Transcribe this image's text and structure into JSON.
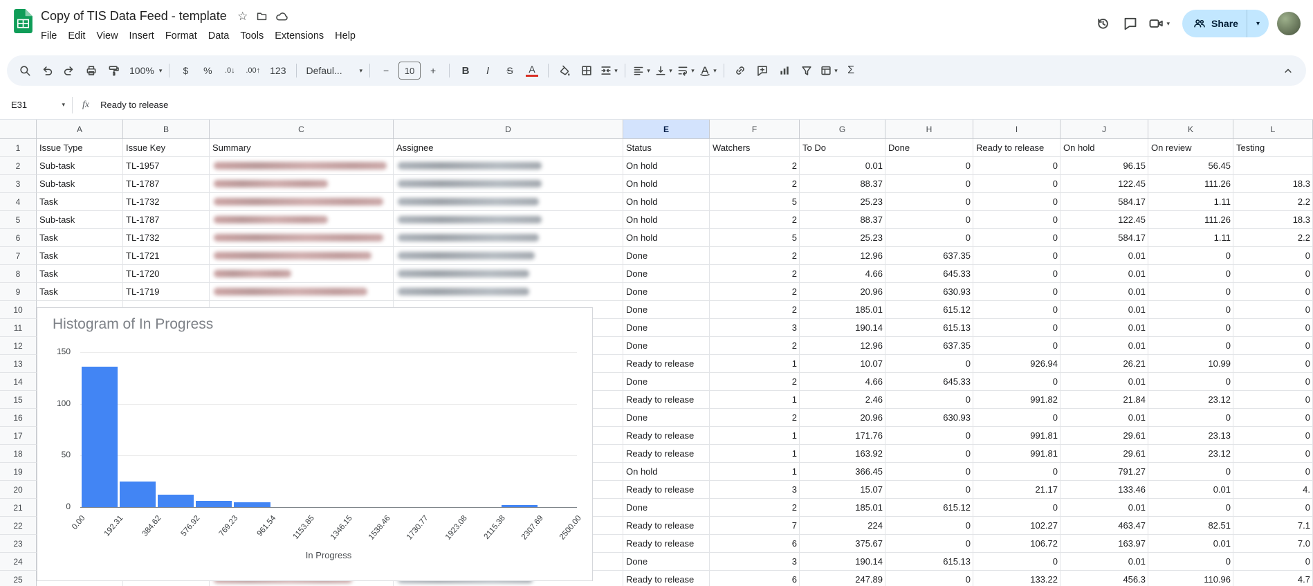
{
  "titlebar": {
    "doc_title": "Copy of TIS Data Feed - template",
    "menus": [
      "File",
      "Edit",
      "View",
      "Insert",
      "Format",
      "Data",
      "Tools",
      "Extensions",
      "Help"
    ],
    "share_label": "Share",
    "doc_actions": [
      "star-icon",
      "move-icon",
      "document-status-icon"
    ],
    "right_actions": [
      "version-history-icon",
      "comments-icon",
      "meet-video-icon",
      "share-button",
      "account-avatar"
    ]
  },
  "toolbar": {
    "items": [
      {
        "name": "menus-search-icon",
        "kind": "icon",
        "icon": "search"
      },
      {
        "name": "undo-icon",
        "kind": "icon",
        "icon": "undo"
      },
      {
        "name": "redo-icon",
        "kind": "icon",
        "icon": "redo"
      },
      {
        "name": "print-icon",
        "kind": "icon",
        "icon": "print"
      },
      {
        "name": "paint-format-icon",
        "kind": "icon",
        "icon": "paint"
      },
      {
        "name": "zoom-select",
        "kind": "select",
        "label": "100%",
        "caret": true
      },
      {
        "kind": "divider"
      },
      {
        "name": "currency-format-button",
        "kind": "text",
        "label": "$"
      },
      {
        "name": "percent-format-button",
        "kind": "text",
        "label": "%"
      },
      {
        "name": "decrease-decimal-button",
        "kind": "text",
        "label": ".0↓",
        "small": true
      },
      {
        "name": "increase-decimal-button",
        "kind": "text",
        "label": ".00↑",
        "small": true
      },
      {
        "name": "number-format-button",
        "kind": "text",
        "label": "123"
      },
      {
        "kind": "divider"
      },
      {
        "name": "font-select",
        "kind": "select",
        "label": "Defaul...",
        "caret": true,
        "wide": true
      },
      {
        "kind": "divider"
      },
      {
        "name": "decrease-font-size-button",
        "kind": "text",
        "label": "−"
      },
      {
        "name": "font-size-input",
        "kind": "input",
        "value": "10"
      },
      {
        "name": "increase-font-size-button",
        "kind": "text",
        "label": "+"
      },
      {
        "kind": "divider"
      },
      {
        "name": "bold-button",
        "kind": "text",
        "label": "B",
        "cls": "b"
      },
      {
        "name": "italic-button",
        "kind": "text",
        "label": "I",
        "cls": "i"
      },
      {
        "name": "strikethrough-button",
        "kind": "text",
        "label": "S",
        "cls": "s"
      },
      {
        "name": "text-color-button",
        "kind": "text",
        "label": "A",
        "cls": "tc"
      },
      {
        "kind": "divider"
      },
      {
        "name": "fill-color-icon",
        "kind": "icon",
        "icon": "bucket"
      },
      {
        "name": "borders-icon",
        "kind": "icon",
        "icon": "borders"
      },
      {
        "name": "merge-cells-icon",
        "kind": "icon",
        "icon": "merge",
        "caret": true
      },
      {
        "kind": "divider"
      },
      {
        "name": "horizontal-align-icon",
        "kind": "icon",
        "icon": "alignleft",
        "caret": true
      },
      {
        "name": "vertical-align-icon",
        "kind": "icon",
        "icon": "valign",
        "caret": true
      },
      {
        "name": "text-wrap-icon",
        "kind": "icon",
        "icon": "wrap",
        "caret": true
      },
      {
        "name": "text-rotation-icon",
        "kind": "icon",
        "icon": "rotate",
        "caret": true
      },
      {
        "kind": "divider"
      },
      {
        "name": "insert-link-icon",
        "kind": "icon",
        "icon": "link"
      },
      {
        "name": "insert-comment-icon",
        "kind": "icon",
        "icon": "addcomment"
      },
      {
        "name": "insert-chart-icon",
        "kind": "icon",
        "icon": "chart"
      },
      {
        "name": "create-filter-icon",
        "kind": "icon",
        "icon": "filter"
      },
      {
        "name": "table-views-icon",
        "kind": "icon",
        "icon": "views",
        "caret": true
      },
      {
        "name": "functions-button",
        "kind": "text",
        "label": "Σ",
        "cls": "sigma"
      }
    ],
    "collapse_name": "hide-toolbar-icon"
  },
  "formula_bar": {
    "cell_ref": "E31",
    "fx_label": "fx",
    "value": "Ready to release"
  },
  "grid": {
    "col_letters": [
      "A",
      "B",
      "C",
      "D",
      "E",
      "F",
      "G",
      "H",
      "I",
      "J",
      "K",
      "L"
    ],
    "active_column": "E",
    "rows": [
      {
        "n": "1",
        "type": "Issue Type",
        "key": "Issue Key",
        "summary": "Summary",
        "assignee": "Assignee",
        "status": "Status",
        "watchers": "Watchers",
        "todo": "To Do",
        "done": "Done",
        "ready": "Ready to release",
        "onhold": "On hold",
        "onreview": "On review",
        "testing": "Testing"
      },
      {
        "n": "2",
        "type": "Sub-task",
        "key": "TL-1957",
        "status": "On hold",
        "watchers": "2",
        "todo": "0.01",
        "done": "0",
        "ready": "0",
        "onhold": "96.15",
        "onreview": "56.45",
        "testing": "",
        "blur_summary": true,
        "blur_assignee": true
      },
      {
        "n": "3",
        "type": "Sub-task",
        "key": "TL-1787",
        "status": "On hold",
        "watchers": "2",
        "todo": "88.37",
        "done": "0",
        "ready": "0",
        "onhold": "122.45",
        "onreview": "111.26",
        "testing": "18.3",
        "blur_summary": true,
        "blur_assignee": true
      },
      {
        "n": "4",
        "type": "Task",
        "key": "TL-1732",
        "status": "On hold",
        "watchers": "5",
        "todo": "25.23",
        "done": "0",
        "ready": "0",
        "onhold": "584.17",
        "onreview": "1.11",
        "testing": "2.2",
        "blur_summary": true,
        "blur_assignee": true
      },
      {
        "n": "5",
        "type": "Sub-task",
        "key": "TL-1787",
        "status": "On hold",
        "watchers": "2",
        "todo": "88.37",
        "done": "0",
        "ready": "0",
        "onhold": "122.45",
        "onreview": "111.26",
        "testing": "18.3",
        "blur_summary": true,
        "blur_assignee": true
      },
      {
        "n": "6",
        "type": "Task",
        "key": "TL-1732",
        "status": "On hold",
        "watchers": "5",
        "todo": "25.23",
        "done": "0",
        "ready": "0",
        "onhold": "584.17",
        "onreview": "1.11",
        "testing": "2.2",
        "blur_summary": true,
        "blur_assignee": true
      },
      {
        "n": "7",
        "type": "Task",
        "key": "TL-1721",
        "status": "Done",
        "watchers": "2",
        "todo": "12.96",
        "done": "637.35",
        "ready": "0",
        "onhold": "0.01",
        "onreview": "0",
        "testing": "0",
        "blur_summary": true,
        "blur_assignee": true
      },
      {
        "n": "8",
        "type": "Task",
        "key": "TL-1720",
        "status": "Done",
        "watchers": "2",
        "todo": "4.66",
        "done": "645.33",
        "ready": "0",
        "onhold": "0.01",
        "onreview": "0",
        "testing": "0",
        "blur_summary": true,
        "blur_assignee": true
      },
      {
        "n": "9",
        "type": "Task",
        "key": "TL-1719",
        "status": "Done",
        "watchers": "2",
        "todo": "20.96",
        "done": "630.93",
        "ready": "0",
        "onhold": "0.01",
        "onreview": "0",
        "testing": "0",
        "blur_summary": true,
        "blur_assignee": true
      },
      {
        "n": "10",
        "status": "Done",
        "watchers": "2",
        "todo": "185.01",
        "done": "615.12",
        "ready": "0",
        "onhold": "0.01",
        "onreview": "0",
        "testing": "0"
      },
      {
        "n": "11",
        "status": "Done",
        "watchers": "3",
        "todo": "190.14",
        "done": "615.13",
        "ready": "0",
        "onhold": "0.01",
        "onreview": "0",
        "testing": "0"
      },
      {
        "n": "12",
        "status": "Done",
        "watchers": "2",
        "todo": "12.96",
        "done": "637.35",
        "ready": "0",
        "onhold": "0.01",
        "onreview": "0",
        "testing": "0"
      },
      {
        "n": "13",
        "status": "Ready to release",
        "watchers": "1",
        "todo": "10.07",
        "done": "0",
        "ready": "926.94",
        "onhold": "26.21",
        "onreview": "10.99",
        "testing": "0"
      },
      {
        "n": "14",
        "status": "Done",
        "watchers": "2",
        "todo": "4.66",
        "done": "645.33",
        "ready": "0",
        "onhold": "0.01",
        "onreview": "0",
        "testing": "0"
      },
      {
        "n": "15",
        "status": "Ready to release",
        "watchers": "1",
        "todo": "2.46",
        "done": "0",
        "ready": "991.82",
        "onhold": "21.84",
        "onreview": "23.12",
        "testing": "0"
      },
      {
        "n": "16",
        "status": "Done",
        "watchers": "2",
        "todo": "20.96",
        "done": "630.93",
        "ready": "0",
        "onhold": "0.01",
        "onreview": "0",
        "testing": "0"
      },
      {
        "n": "17",
        "status": "Ready to release",
        "watchers": "1",
        "todo": "171.76",
        "done": "0",
        "ready": "991.81",
        "onhold": "29.61",
        "onreview": "23.13",
        "testing": "0"
      },
      {
        "n": "18",
        "status": "Ready to release",
        "watchers": "1",
        "todo": "163.92",
        "done": "0",
        "ready": "991.81",
        "onhold": "29.61",
        "onreview": "23.12",
        "testing": "0"
      },
      {
        "n": "19",
        "status": "On hold",
        "watchers": "1",
        "todo": "366.45",
        "done": "0",
        "ready": "0",
        "onhold": "791.27",
        "onreview": "0",
        "testing": "0"
      },
      {
        "n": "20",
        "status": "Ready to release",
        "watchers": "3",
        "todo": "15.07",
        "done": "0",
        "ready": "21.17",
        "onhold": "133.46",
        "onreview": "0.01",
        "testing": "4."
      },
      {
        "n": "21",
        "status": "Done",
        "watchers": "2",
        "todo": "185.01",
        "done": "615.12",
        "ready": "0",
        "onhold": "0.01",
        "onreview": "0",
        "testing": "0"
      },
      {
        "n": "22",
        "status": "Ready to release",
        "watchers": "7",
        "todo": "224",
        "done": "0",
        "ready": "102.27",
        "onhold": "463.47",
        "onreview": "82.51",
        "testing": "7.1"
      },
      {
        "n": "23",
        "status": "Ready to release",
        "watchers": "6",
        "todo": "375.67",
        "done": "0",
        "ready": "106.72",
        "onhold": "163.97",
        "onreview": "0.01",
        "testing": "7.0"
      },
      {
        "n": "24",
        "status": "Done",
        "watchers": "3",
        "todo": "190.14",
        "done": "615.13",
        "ready": "0",
        "onhold": "0.01",
        "onreview": "0",
        "testing": "0"
      },
      {
        "n": "25",
        "status": "Ready to release",
        "watchers": "6",
        "todo": "247.89",
        "done": "0",
        "ready": "133.22",
        "onhold": "456.3",
        "onreview": "110.96",
        "testing": "4.7",
        "blur_summary": true,
        "blur_assignee": true
      }
    ]
  },
  "chart_data": {
    "type": "bar",
    "subtype": "histogram",
    "title": "Histogram of In Progress",
    "xlabel": "In Progress",
    "ylabel": "",
    "bin_labels": [
      "0.00",
      "192.31",
      "384.62",
      "576.92",
      "769.23",
      "961.54",
      "1153.85",
      "1346.15",
      "1538.46",
      "1730.77",
      "1923.08",
      "2115.38",
      "2307.69",
      "2500.00"
    ],
    "values": [
      136,
      25,
      12,
      6,
      5,
      0,
      0,
      0,
      0,
      0,
      0,
      2,
      0
    ],
    "yticks": [
      0,
      50,
      100,
      150
    ],
    "ylim": [
      0,
      150
    ],
    "bar_color": "#4285f4",
    "grid": true,
    "legend": "none"
  }
}
